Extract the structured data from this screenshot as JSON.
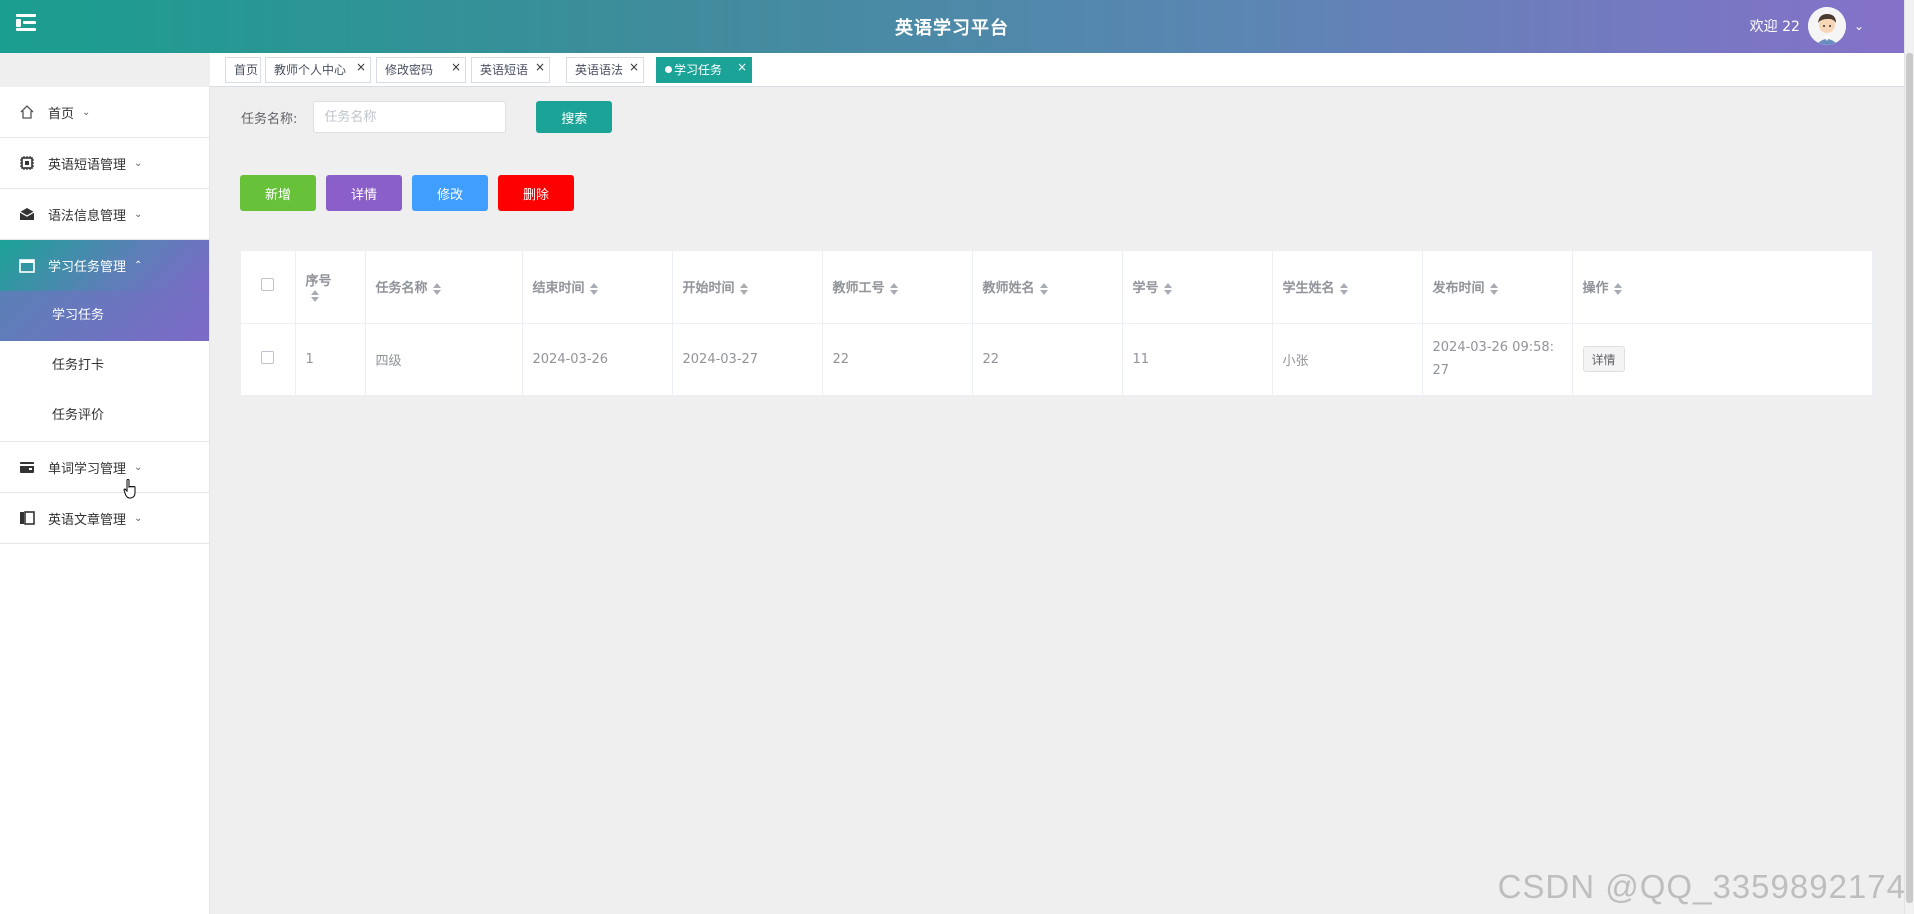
{
  "header": {
    "title": "英语学习平台",
    "welcome": "欢迎 22"
  },
  "tabs": [
    {
      "label": "首页",
      "closable": false,
      "active": false
    },
    {
      "label": "教师个人中心",
      "closable": true,
      "active": false
    },
    {
      "label": "修改密码",
      "closable": true,
      "active": false
    },
    {
      "label": "英语短语",
      "closable": true,
      "active": false
    },
    {
      "label": "英语语法",
      "closable": true,
      "active": false
    },
    {
      "label": "学习任务",
      "closable": true,
      "active": true
    }
  ],
  "sidebar": {
    "items": [
      {
        "label": "首页",
        "icon": "home-icon"
      },
      {
        "label": "英语短语管理",
        "icon": "chip-icon"
      },
      {
        "label": "语法信息管理",
        "icon": "envelope-icon"
      },
      {
        "label": "学习任务管理",
        "icon": "window-icon",
        "open": true,
        "children": [
          {
            "label": "学习任务",
            "active": true
          },
          {
            "label": "任务打卡"
          },
          {
            "label": "任务评价"
          }
        ]
      },
      {
        "label": "单词学习管理",
        "icon": "wallet-icon"
      },
      {
        "label": "英语文章管理",
        "icon": "columns-icon"
      }
    ]
  },
  "search": {
    "label": "任务名称:",
    "placeholder": "任务名称",
    "value": "",
    "button": "搜索"
  },
  "actions": {
    "add": "新增",
    "detail": "详情",
    "edit": "修改",
    "delete": "删除"
  },
  "colors": {
    "primary": "#1aa396",
    "add": "#67c23a",
    "detail": "#8b5fc9",
    "edit": "#409eff",
    "delete": "#ff0000"
  },
  "table": {
    "columns": [
      "序号",
      "任务名称",
      "结束时间",
      "开始时间",
      "教师工号",
      "教师姓名",
      "学号",
      "学生姓名",
      "发布时间",
      "操作"
    ],
    "rows": [
      {
        "index": "1",
        "task_name": "四级",
        "end_time": "2024-03-26",
        "start_time": "2024-03-27",
        "teacher_id": "22",
        "teacher_name": "22",
        "student_id": "11",
        "student_name": "小张",
        "publish_time": "2024-03-26 09:58:27",
        "action": "详情"
      }
    ]
  },
  "watermark": "CSDN @QQ_3359892174"
}
